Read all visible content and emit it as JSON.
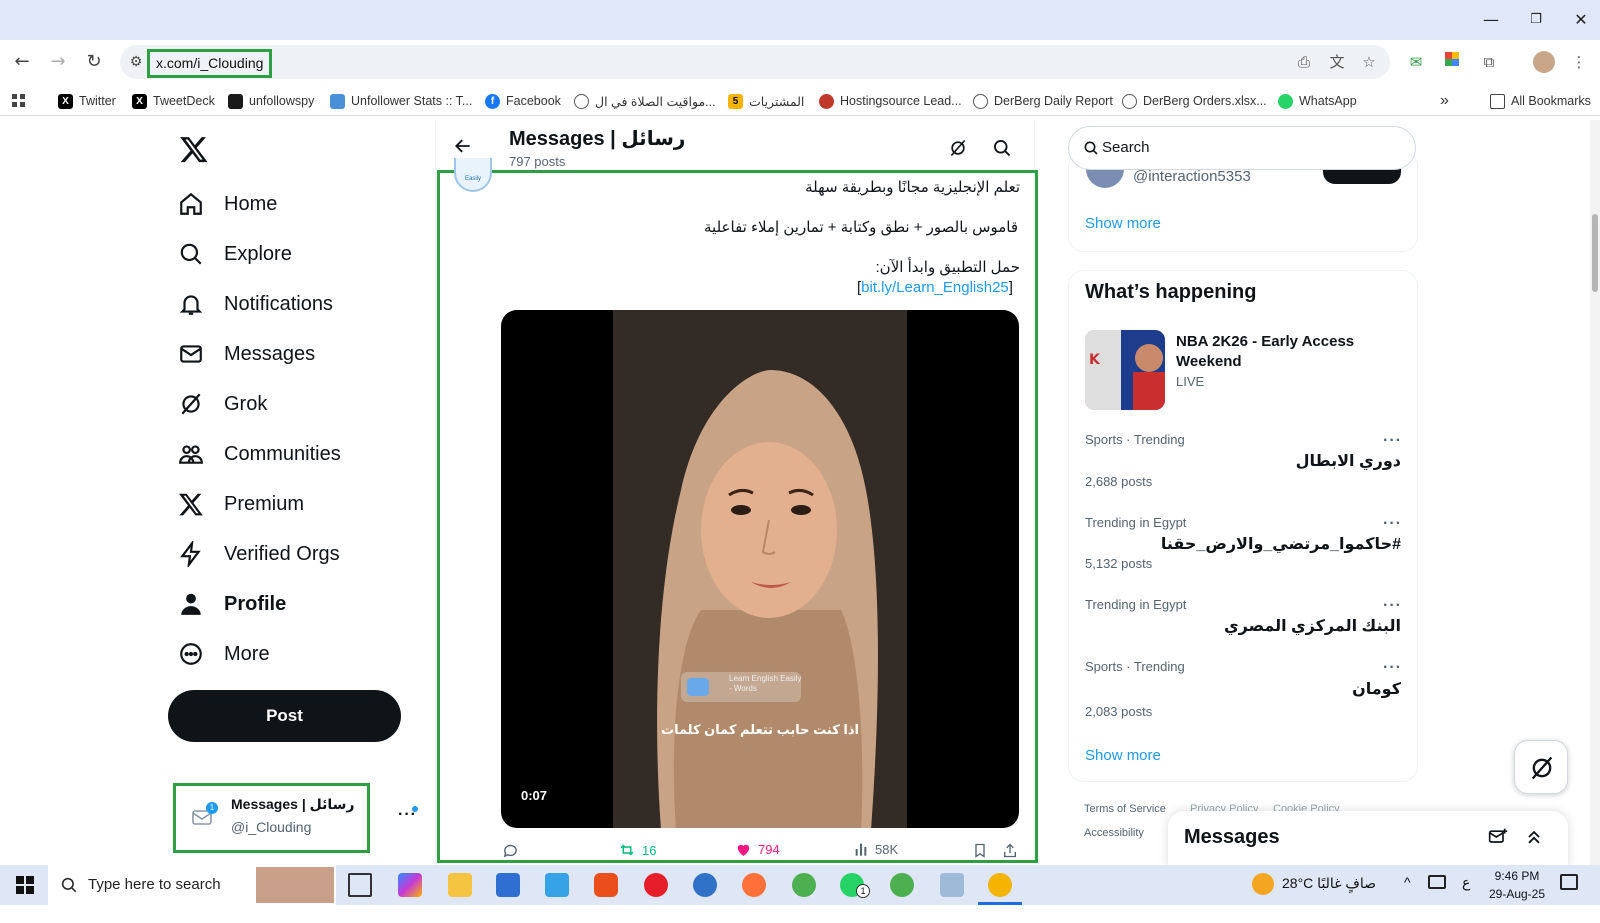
{
  "browser": {
    "url": "x.com/i_Clouding",
    "bookmarks": [
      {
        "label": "Twitter",
        "icon": "x-logo-icon",
        "color": "#000000"
      },
      {
        "label": "TweetDeck",
        "icon": "x-logo-icon",
        "color": "#000000"
      },
      {
        "label": "unfollowspy",
        "icon": "unfollowspy-icon",
        "color": "#1a1a1a"
      },
      {
        "label": "Unfollower Stats :: T...",
        "icon": "stats-icon",
        "color": "#4a90d9"
      },
      {
        "label": "Facebook",
        "icon": "facebook-icon",
        "color": "#1877f2"
      },
      {
        "label": "مواقيت الصلاة في ال...",
        "icon": "globe-icon",
        "color": "#555555"
      },
      {
        "label": "المشتريات",
        "icon": "sheet-icon",
        "color": "#f5b400"
      },
      {
        "label": "Hostingsource Lead...",
        "icon": "hosting-icon",
        "color": "#c0392b"
      },
      {
        "label": "DerBerg Daily Report",
        "icon": "globe-icon",
        "color": "#555555"
      },
      {
        "label": "DerBerg Orders.xlsx...",
        "icon": "globe-icon",
        "color": "#555555"
      },
      {
        "label": "WhatsApp",
        "icon": "whatsapp-icon",
        "color": "#25d366"
      }
    ],
    "overflow": "»",
    "all_bookmarks": "All Bookmarks"
  },
  "sidebar": {
    "items": [
      {
        "label": "Home",
        "icon": "home-icon"
      },
      {
        "label": "Explore",
        "icon": "search-icon"
      },
      {
        "label": "Notifications",
        "icon": "bell-icon"
      },
      {
        "label": "Messages",
        "icon": "mail-icon"
      },
      {
        "label": "Grok",
        "icon": "grok-icon"
      },
      {
        "label": "Communities",
        "icon": "communities-icon"
      },
      {
        "label": "Premium",
        "icon": "x-logo-icon"
      },
      {
        "label": "Verified Orgs",
        "icon": "lightning-icon"
      },
      {
        "label": "Profile",
        "icon": "person-icon"
      },
      {
        "label": "More",
        "icon": "more-circle-icon"
      }
    ],
    "post_label": "Post",
    "account": {
      "name": "Messages | رسائل",
      "handle": "@i_Clouding",
      "badge": "1"
    }
  },
  "header": {
    "title": "Messages | رسائل",
    "post_count": "797 posts"
  },
  "tweet": {
    "line1": "تعلم الإنجليزية مجانًا وبطريقة سهلة",
    "line2": "قاموس بالصور + نطق وكتابة + تمارين إملاء تفاعلية",
    "line3": "حمل التطبيق وابدأ الآن:",
    "link_open": "[",
    "link": "bit.ly/Learn_English25",
    "link_close": "]",
    "video_time": "0:07",
    "video_watermark_line1": "Learn English Easily",
    "video_watermark_line2": "- Words",
    "video_caption": "اذا كنت حابب تتعلم كمان كلمات",
    "avatar_text": "Easily",
    "actions": {
      "replies": "",
      "reposts": "16",
      "likes": "794",
      "views": "58K"
    },
    "colors": {
      "repost": "#00ba7c",
      "like": "#f91880"
    }
  },
  "right": {
    "search_placeholder": "Search",
    "top_card": {
      "handle": "@interaction5353",
      "show_more": "Show more"
    },
    "happening": {
      "title": "What’s happening",
      "featured": {
        "title": "NBA 2K26 - Early Access Weekend",
        "status": "LIVE"
      },
      "trends": [
        {
          "meta": "Sports · Trending",
          "title": "دوري الابطال",
          "posts": "2,688 posts"
        },
        {
          "meta": "Trending in Egypt",
          "title": "#حاكموا_مرتضي_والارض_حقنا",
          "posts": "5,132 posts"
        },
        {
          "meta": "Trending in Egypt",
          "title": "البنك المركزي المصري",
          "posts": ""
        },
        {
          "meta": "Sports · Trending",
          "title": "كومان",
          "posts": "2,083 posts"
        }
      ],
      "show_more": "Show more",
      "more_dots": "···"
    },
    "footer": {
      "terms": "Terms of Service",
      "privacy": "Privacy Policy",
      "cookie": "Cookie Policy",
      "accessibility": "Accessibility"
    },
    "messages_drawer": "Messages"
  },
  "taskbar": {
    "search_placeholder": "Type here to search",
    "weather": "28°C  صافٍ غالبًا",
    "lang": "ع",
    "time": "9:46 PM",
    "date": "29-Aug-25",
    "whatsapp_badge": "1"
  }
}
